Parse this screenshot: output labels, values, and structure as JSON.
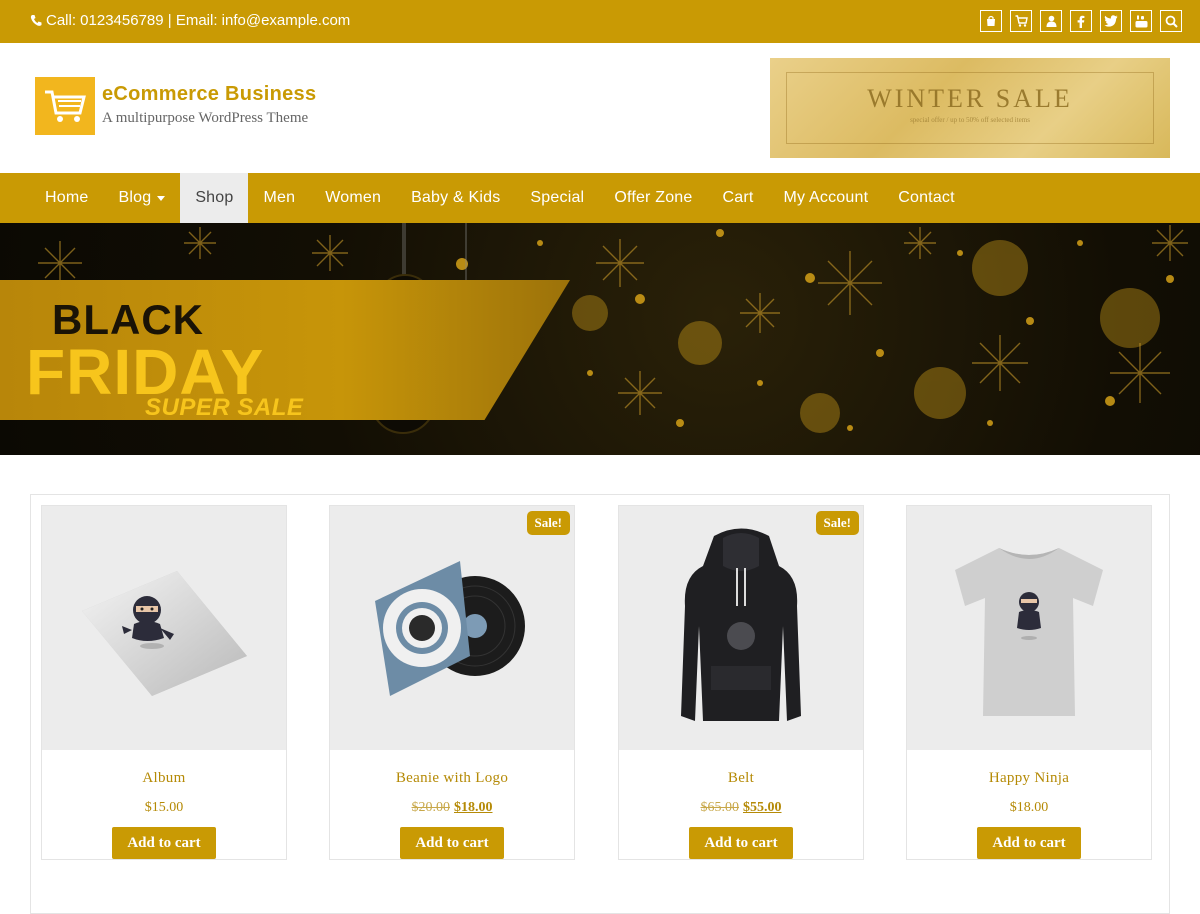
{
  "topbar": {
    "contact_text": "Call: 0123456789 | Email: info@example.com",
    "icons": [
      "shopping-bag-icon",
      "cart-icon",
      "user-icon",
      "facebook-icon",
      "twitter-icon",
      "youtube-icon",
      "search-icon"
    ]
  },
  "header": {
    "brand_name": "eCommerce Business",
    "tagline": "A multipurpose WordPress Theme",
    "ad": {
      "title": "WINTER SALE",
      "subtitle": "special offer / up to 50% off selected items"
    }
  },
  "nav": {
    "items": [
      {
        "label": "Home"
      },
      {
        "label": "Blog",
        "has_dropdown": true
      },
      {
        "label": "Shop",
        "active": true
      },
      {
        "label": "Men"
      },
      {
        "label": "Women"
      },
      {
        "label": "Baby & Kids"
      },
      {
        "label": "Special"
      },
      {
        "label": "Offer Zone"
      },
      {
        "label": "Cart"
      },
      {
        "label": "My Account"
      },
      {
        "label": "Contact"
      }
    ]
  },
  "hero": {
    "line1": "BLACK",
    "line2": "FRIDAY",
    "line3": "SUPER SALE"
  },
  "products": [
    {
      "name": "Album",
      "price": "$15.00",
      "old_price": "",
      "sale_badge": "",
      "button": "Add to cart"
    },
    {
      "name": "Beanie with Logo",
      "price": "$18.00",
      "old_price": "$20.00",
      "sale_badge": "Sale!",
      "button": "Add to cart"
    },
    {
      "name": "Belt",
      "price": "$55.00",
      "old_price": "$65.00",
      "sale_badge": "Sale!",
      "button": "Add to cart"
    },
    {
      "name": "Happy Ninja",
      "price": "$18.00",
      "old_price": "",
      "sale_badge": "",
      "button": "Add to cart"
    }
  ],
  "colors": {
    "brand": "#c99a04",
    "logo_box": "#f2b61e",
    "nav_active_bg": "#ececec",
    "product_text": "#b58a06"
  }
}
